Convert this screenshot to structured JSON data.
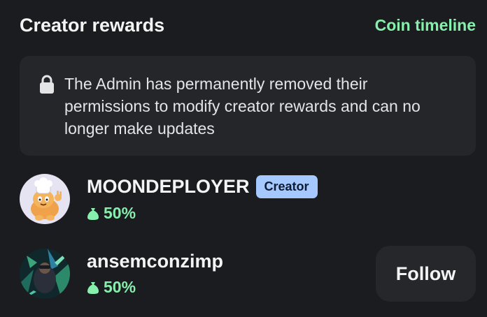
{
  "header": {
    "title": "Creator rewards",
    "timeline_link": "Coin timeline"
  },
  "notice": {
    "icon": "lock-icon",
    "text": "The Admin has permanently removed their permissions to modify creator rewards and can no longer make updates"
  },
  "users": [
    {
      "name": "MOONDEPLOYER",
      "badge": "Creator",
      "share": "50%",
      "share_icon": "money-bag-icon"
    },
    {
      "name": "ansemconzimp",
      "share": "50%",
      "share_icon": "money-bag-icon",
      "follow_label": "Follow"
    }
  ],
  "colors": {
    "background": "#1b1c1f",
    "card": "#25262a",
    "accent_green": "#86efac",
    "badge_blue": "#a5c8ff"
  }
}
